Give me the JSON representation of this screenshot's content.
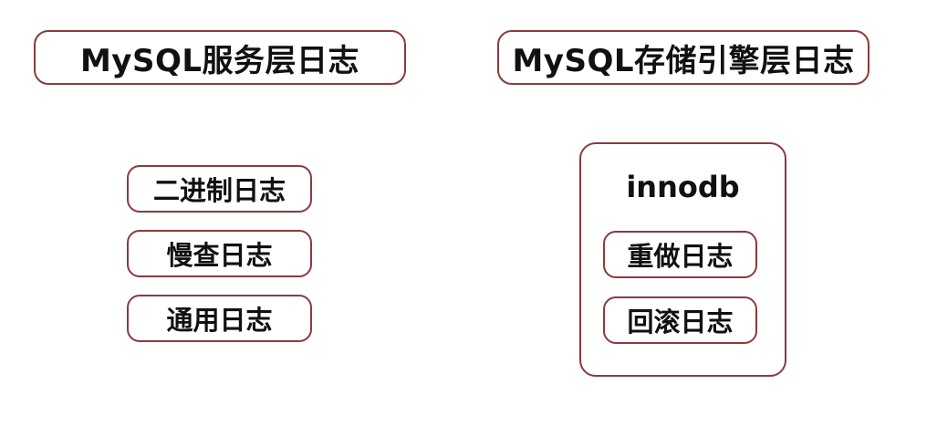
{
  "service_layer": {
    "title": "MySQL服务层日志",
    "logs": [
      "二进制日志",
      "慢查日志",
      "通用日志"
    ]
  },
  "storage_layer": {
    "title": "MySQL存储引擎层日志",
    "engine": {
      "name": "innodb",
      "logs": [
        "重做日志",
        "回滚日志"
      ]
    }
  },
  "colors": {
    "border": "#8b3a3e",
    "text": "#111111",
    "background": "#ffffff"
  }
}
